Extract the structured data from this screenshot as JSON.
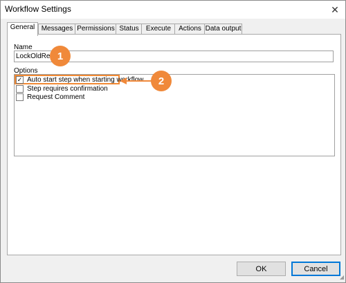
{
  "window": {
    "title": "Workflow Settings",
    "close_glyph": "✕"
  },
  "tabs": [
    {
      "label": "General",
      "active": true
    },
    {
      "label": "Messages",
      "active": false
    },
    {
      "label": "Permissions",
      "active": false
    },
    {
      "label": "Status",
      "active": false
    },
    {
      "label": "Execute",
      "active": false
    },
    {
      "label": "Actions",
      "active": false
    },
    {
      "label": "Data output",
      "active": false
    }
  ],
  "general": {
    "name_label": "Name",
    "name_value": "LockOldRev",
    "options_label": "Options",
    "options": [
      {
        "label": "Auto start step when starting workflow",
        "checked": true
      },
      {
        "label": "Step requires confirmation",
        "checked": false
      },
      {
        "label": "Request Comment",
        "checked": false
      }
    ]
  },
  "callouts": {
    "one": "1",
    "two": "2"
  },
  "buttons": {
    "ok": "OK",
    "cancel": "Cancel"
  },
  "colors": {
    "callout": "#f0893a",
    "accent": "#0078d7"
  },
  "icons": {
    "checkmark": "✓",
    "close": "close-icon",
    "grip": "resize-grip-icon"
  }
}
